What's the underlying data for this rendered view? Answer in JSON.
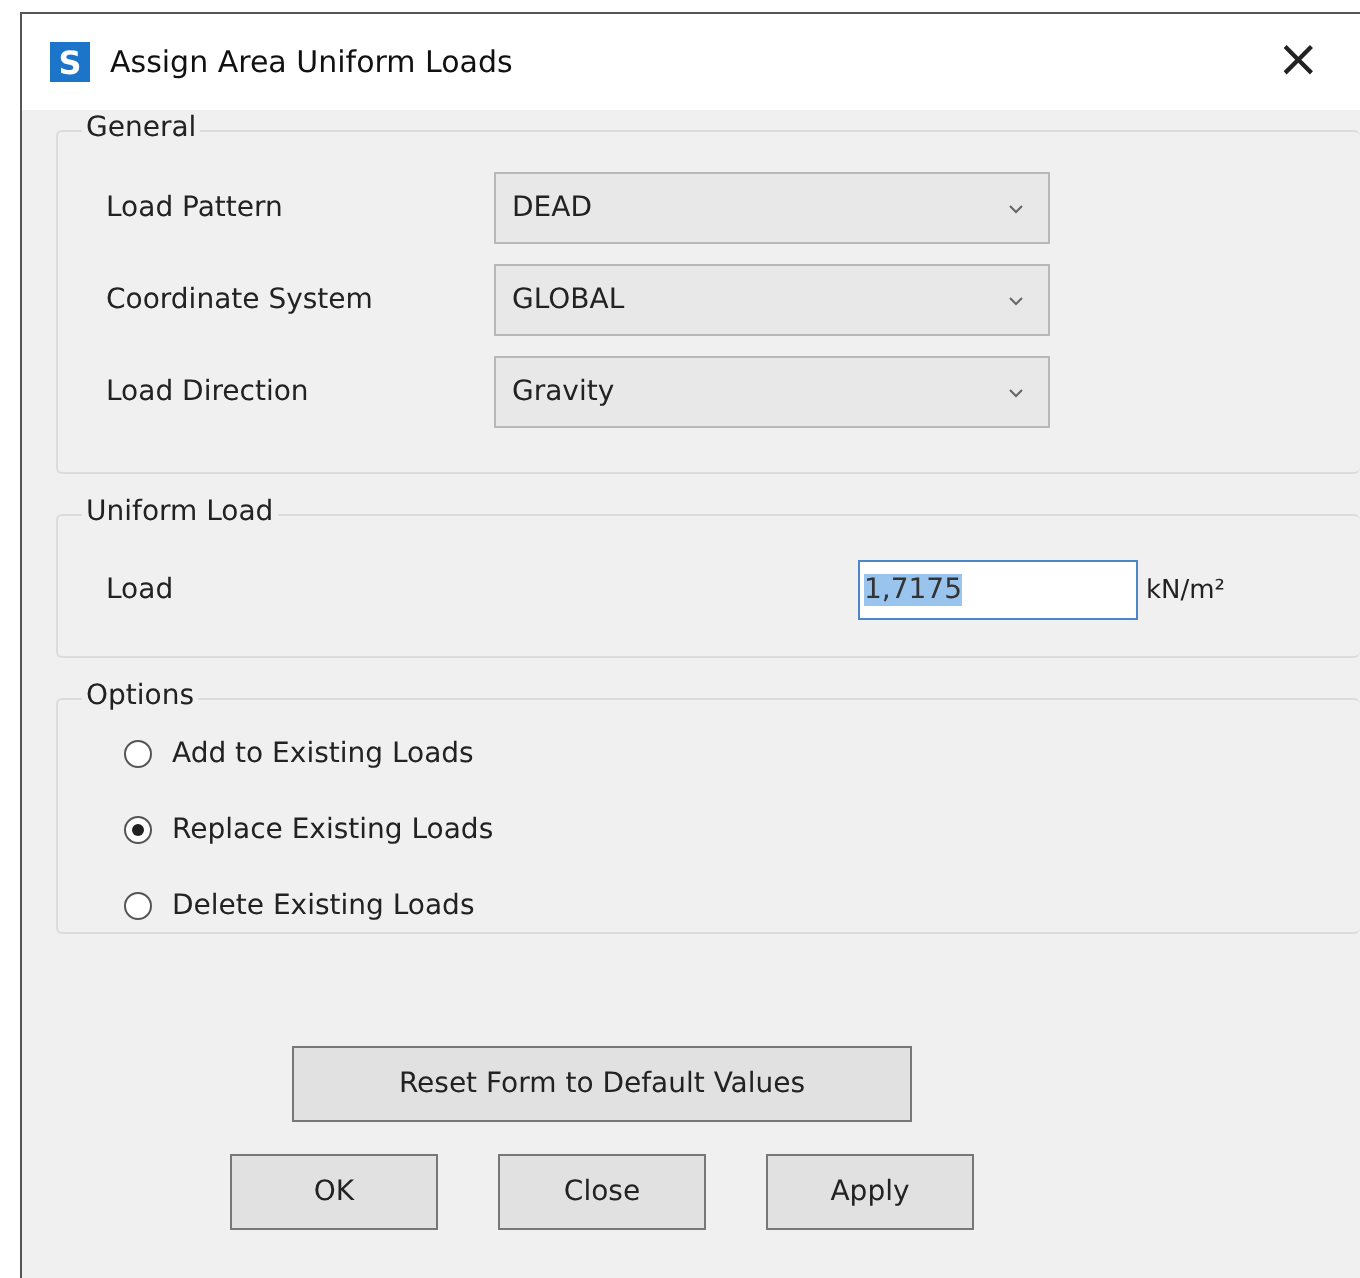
{
  "window": {
    "title": "Assign Area Uniform Loads",
    "icon_letter": "S",
    "close": "×"
  },
  "general": {
    "title": "General",
    "fields": [
      {
        "label": "Load Pattern",
        "value": "DEAD"
      },
      {
        "label": "Coordinate System",
        "value": "GLOBAL"
      },
      {
        "label": "Load Direction",
        "value": "Gravity"
      }
    ]
  },
  "uniform_load": {
    "title": "Uniform Load",
    "label": "Load",
    "value": "1,7175",
    "value_selected": true,
    "unit": "kN/m²"
  },
  "options": {
    "title": "Options",
    "items": [
      {
        "label": "Add to Existing Loads",
        "selected": false
      },
      {
        "label": "Replace Existing Loads",
        "selected": true
      },
      {
        "label": "Delete Existing Loads",
        "selected": false
      }
    ]
  },
  "reset_button": "Reset Form to Default Values",
  "buttons": [
    "OK",
    "Close",
    "Apply"
  ]
}
